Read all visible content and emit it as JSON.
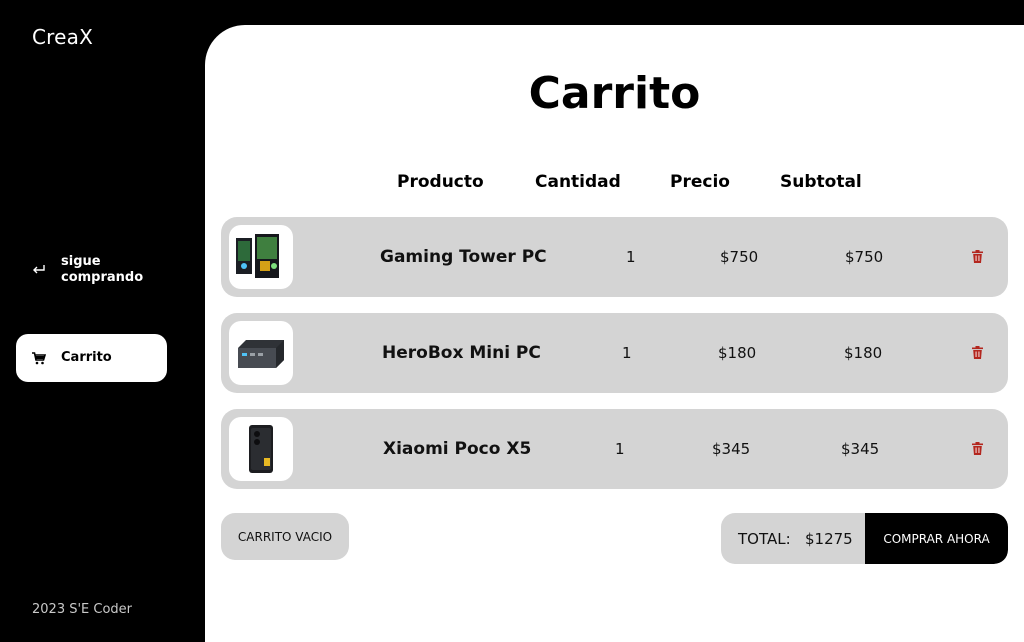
{
  "app": {
    "brand": "CreaX",
    "footer": "2023 S'E Coder"
  },
  "sidebar": {
    "items": [
      {
        "label": "sigue comprando",
        "icon": "return-arrow-icon"
      },
      {
        "label": "Carrito",
        "icon": "cart-icon",
        "active": true
      }
    ]
  },
  "cart": {
    "title": "Carrito",
    "columns": {
      "product": "Producto",
      "quantity": "Cantidad",
      "price": "Precio",
      "subtotal": "Subtotal"
    },
    "rows": [
      {
        "name": "Gaming Tower PC",
        "quantity": "1",
        "price": "$750",
        "subtotal": "$750",
        "image": "gaming-tower-image"
      },
      {
        "name": "HeroBox Mini PC",
        "quantity": "1",
        "price": "$180",
        "subtotal": "$180",
        "image": "mini-pc-image"
      },
      {
        "name": "Xiaomi Poco X5",
        "quantity": "1",
        "price": "$345",
        "subtotal": "$345",
        "image": "phone-image"
      }
    ],
    "empty_button": "CARRITO VACIO",
    "total_label": "TOTAL:",
    "total_value": "$1275",
    "buy_button": "COMPRAR AHORA"
  },
  "colors": {
    "background": "#000000",
    "panel": "#ffffff",
    "row": "#d4d4d4",
    "trash": "#b3261e"
  }
}
